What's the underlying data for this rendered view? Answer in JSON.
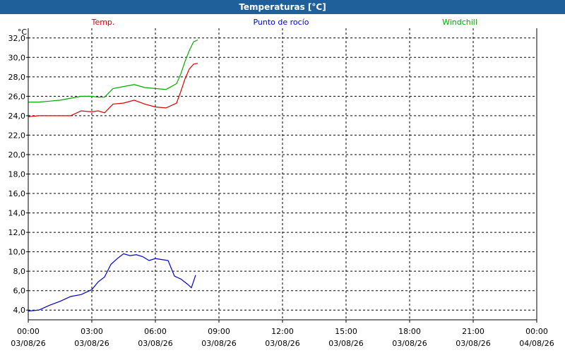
{
  "window": {
    "title": "Temperaturas [°C]"
  },
  "chart_data": {
    "type": "line",
    "title": "Temperaturas [°C]",
    "ylabel": "°C",
    "xlabel": "",
    "ylim": [
      3.0,
      33.0
    ],
    "yticks": [
      4,
      6,
      8,
      10,
      12,
      14,
      16,
      18,
      20,
      22,
      24,
      26,
      28,
      30,
      32
    ],
    "ytick_labels": [
      "4,0",
      "6,0",
      "8,0",
      "10,0",
      "12,0",
      "14,0",
      "16,0",
      "18,0",
      "20,0",
      "22,0",
      "24,0",
      "26,0",
      "28,0",
      "30,0",
      "32,0"
    ],
    "xlim": [
      0,
      24
    ],
    "xticks": [
      {
        "time": "00:00",
        "date": "03/08/26"
      },
      {
        "time": "03:00",
        "date": "03/08/26"
      },
      {
        "time": "06:00",
        "date": "03/08/26"
      },
      {
        "time": "09:00",
        "date": "03/08/26"
      },
      {
        "time": "12:00",
        "date": "03/08/26"
      },
      {
        "time": "15:00",
        "date": "03/08/26"
      },
      {
        "time": "18:00",
        "date": "03/08/26"
      },
      {
        "time": "21:00",
        "date": "03/08/26"
      },
      {
        "time": "00:00",
        "date": "04/08/26"
      }
    ],
    "grid": true,
    "legend_position": "top",
    "series": [
      {
        "name": "Temp.",
        "color": "#dd0000",
        "x": [
          0,
          0.5,
          1,
          1.5,
          2,
          2.5,
          3,
          3.3,
          3.6,
          4,
          4.5,
          5,
          5.5,
          6,
          6.5,
          7,
          7.2,
          7.4,
          7.6,
          7.8,
          8
        ],
        "y": [
          23.9,
          24.0,
          24.0,
          24.0,
          24.0,
          24.5,
          24.4,
          24.5,
          24.3,
          25.2,
          25.3,
          25.6,
          25.2,
          24.9,
          24.8,
          25.3,
          26.5,
          27.8,
          28.8,
          29.3,
          29.4
        ]
      },
      {
        "name": "Punto de rocío",
        "color": "#0000cc",
        "x": [
          0,
          0.5,
          1,
          1.5,
          2,
          2.5,
          3,
          3.3,
          3.6,
          3.9,
          4.2,
          4.5,
          4.8,
          5.1,
          5.4,
          5.7,
          6,
          6.3,
          6.6,
          6.9,
          7.2,
          7.5,
          7.7,
          7.9
        ],
        "y": [
          3.9,
          4.0,
          4.5,
          4.9,
          5.4,
          5.6,
          6.1,
          6.9,
          7.4,
          8.7,
          9.3,
          9.8,
          9.6,
          9.7,
          9.5,
          9.1,
          9.3,
          9.2,
          9.1,
          7.5,
          7.2,
          6.7,
          6.3,
          7.6
        ]
      },
      {
        "name": "Windchill",
        "color": "#00aa00",
        "x": [
          0,
          0.5,
          1,
          1.5,
          2,
          2.5,
          3,
          3.3,
          3.6,
          4,
          4.5,
          5,
          5.5,
          6,
          6.5,
          7,
          7.2,
          7.4,
          7.6,
          7.8,
          8
        ],
        "y": [
          25.4,
          25.4,
          25.5,
          25.6,
          25.8,
          26.0,
          26.0,
          25.9,
          25.9,
          26.8,
          27.0,
          27.2,
          26.9,
          26.8,
          26.7,
          27.3,
          28.3,
          29.6,
          30.7,
          31.6,
          31.8
        ]
      }
    ]
  }
}
